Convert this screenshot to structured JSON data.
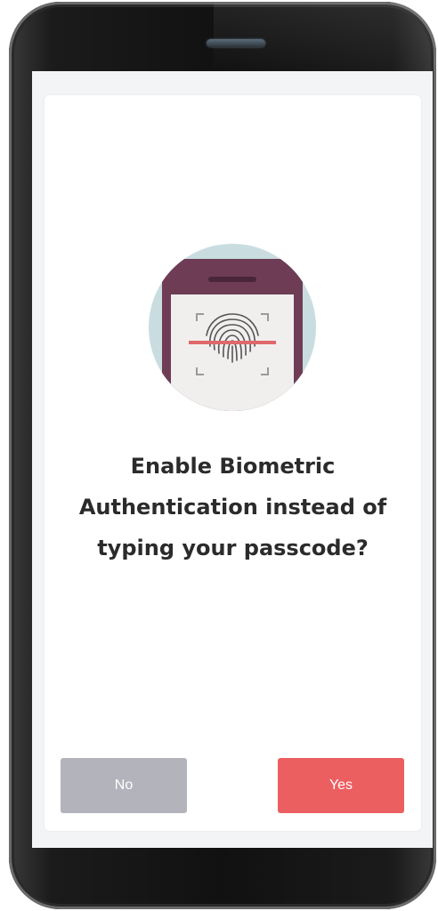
{
  "dialog": {
    "title": "Enable Biometric Authentication instead of typing your passcode?",
    "no_label": "No",
    "yes_label": "Yes"
  },
  "colors": {
    "accent": "#ec5f61",
    "secondary_button": "#b3b4bb",
    "illustration_circle": "#c9dde0",
    "illustration_phone": "#6e3d55",
    "scan_line": "#e0676a"
  },
  "icons": {
    "illustration": "fingerprint-phone-icon"
  }
}
